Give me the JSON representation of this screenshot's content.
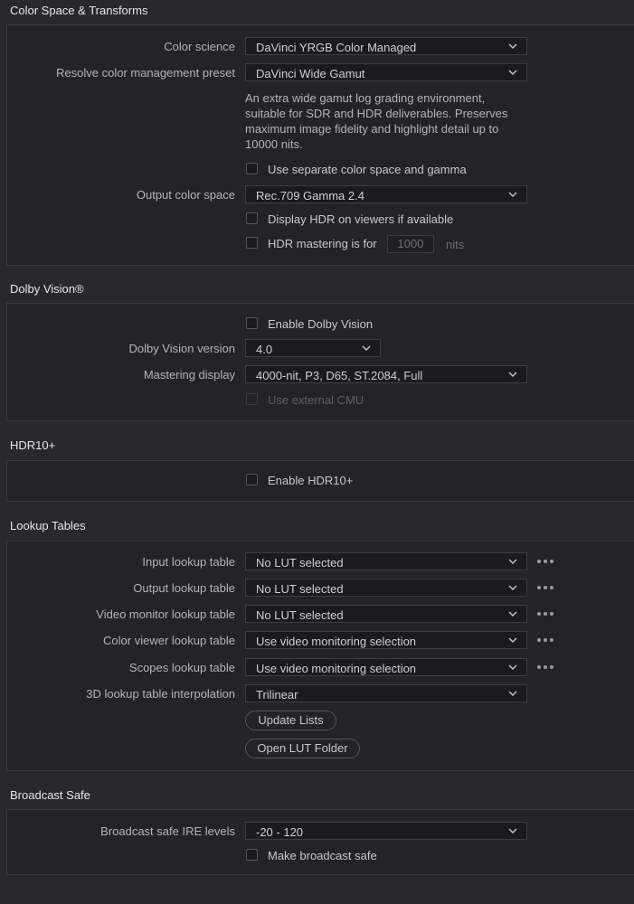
{
  "color_space": {
    "title": "Color Space & Transforms",
    "color_science": {
      "label": "Color science",
      "value": "DaVinci YRGB Color Managed"
    },
    "preset": {
      "label": "Resolve color management preset",
      "value": "DaVinci Wide Gamut"
    },
    "description": "An extra wide gamut log grading environment, suitable for SDR and HDR deliverables. Preserves maximum image fidelity and highlight detail up to 10000 nits.",
    "separate_cs": {
      "label": "Use separate color space and gamma",
      "checked": false
    },
    "output_cs": {
      "label": "Output color space",
      "value": "Rec.709 Gamma 2.4"
    },
    "display_hdr": {
      "label": "Display HDR on viewers if available",
      "checked": false
    },
    "hdr_mastering": {
      "label": "HDR mastering is for",
      "value": "1000",
      "units": "nits",
      "checked": false
    }
  },
  "dolby": {
    "title": "Dolby Vision®",
    "enable": {
      "label": "Enable Dolby Vision",
      "checked": false
    },
    "version": {
      "label": "Dolby Vision version",
      "value": "4.0"
    },
    "mastering": {
      "label": "Mastering display",
      "value": "4000-nit, P3, D65, ST.2084, Full"
    },
    "external_cmu": {
      "label": "Use external CMU",
      "checked": false,
      "disabled": true
    }
  },
  "hdr10": {
    "title": "HDR10+",
    "enable": {
      "label": "Enable HDR10+",
      "checked": false
    }
  },
  "luts": {
    "title": "Lookup Tables",
    "rows": [
      {
        "label": "Input lookup table",
        "value": "No LUT selected"
      },
      {
        "label": "Output lookup table",
        "value": "No LUT selected"
      },
      {
        "label": "Video monitor lookup table",
        "value": "No LUT selected"
      },
      {
        "label": "Color viewer lookup table",
        "value": "Use video monitoring selection"
      },
      {
        "label": "Scopes lookup table",
        "value": "Use video monitoring selection"
      }
    ],
    "interpolation": {
      "label": "3D lookup table interpolation",
      "value": "Trilinear"
    },
    "update_button": "Update Lists",
    "open_button": "Open LUT Folder"
  },
  "broadcast": {
    "title": "Broadcast Safe",
    "ire": {
      "label": "Broadcast safe IRE levels",
      "value": "-20 - 120"
    },
    "make_safe": {
      "label": "Make broadcast safe",
      "checked": false
    }
  },
  "icons": {
    "dropdown": "chevron-down-icon",
    "more": "more-dots-icon"
  },
  "colors": {
    "background": "#28282e",
    "panel": "#232328",
    "field": "#1b1b1f",
    "text": "#c8c8cc"
  }
}
